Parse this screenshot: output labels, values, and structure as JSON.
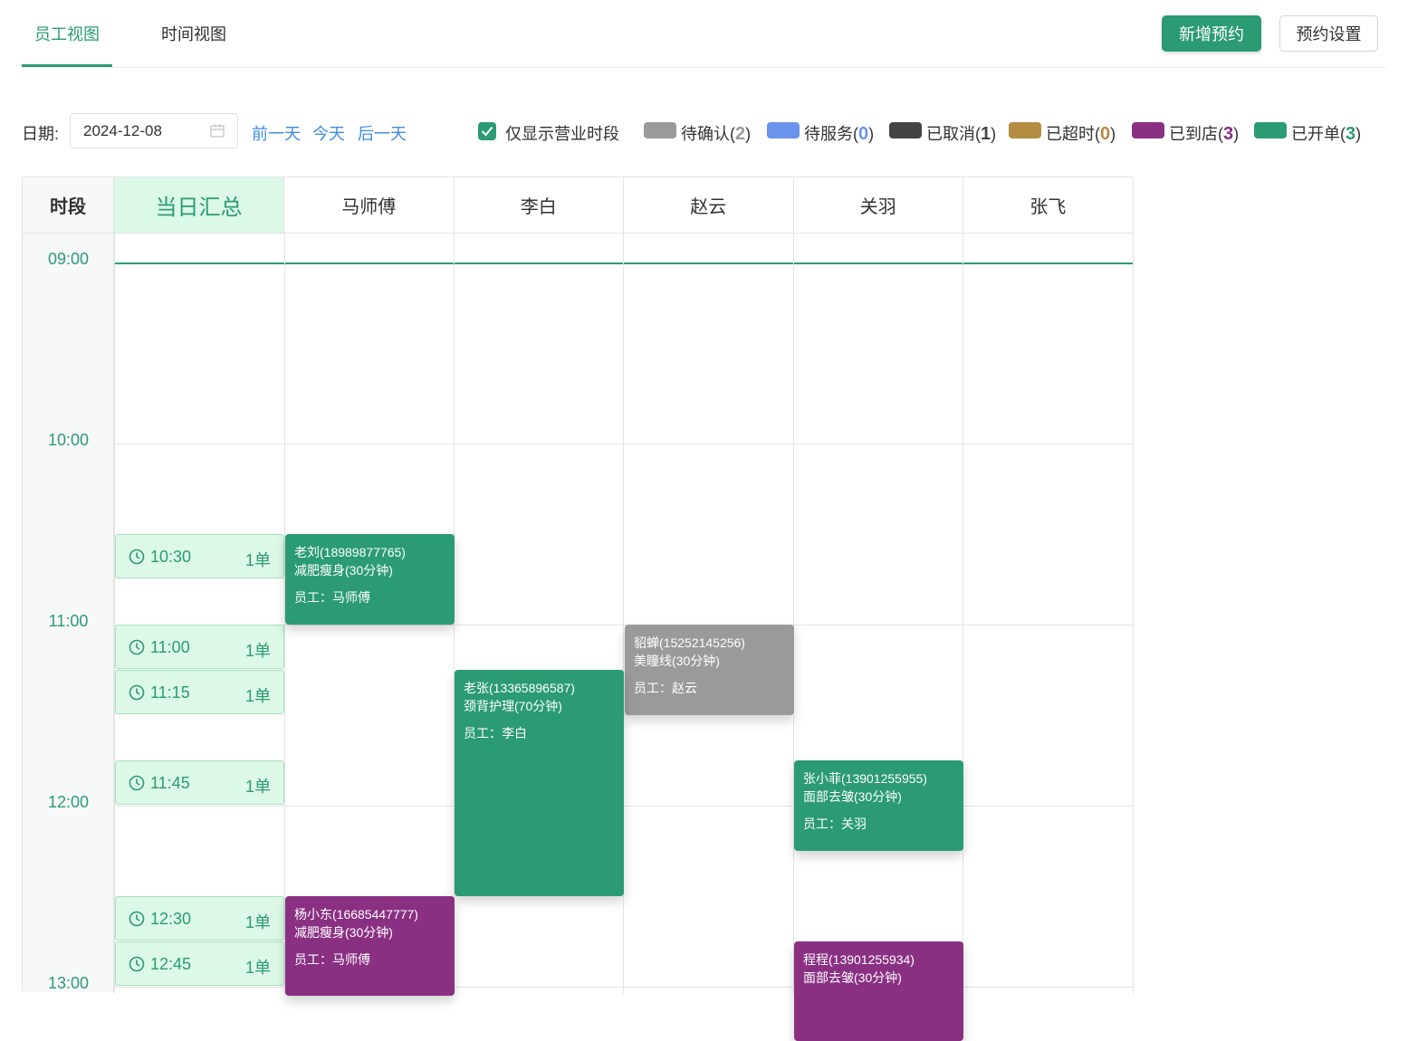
{
  "tabs": [
    {
      "label": "员工视图",
      "active": true
    },
    {
      "label": "时间视图",
      "active": false
    }
  ],
  "actions": {
    "new_label": "新增预约",
    "settings_label": "预约设置"
  },
  "filter": {
    "date_label": "日期:",
    "date_value": "2024-12-08",
    "prev_day": "前一天",
    "today": "今天",
    "next_day": "后一天",
    "checkbox_label": "仅显示营业时段",
    "checkbox_checked": true
  },
  "legend": [
    {
      "label": "待确认",
      "count": "2",
      "color": "#9a9a9a"
    },
    {
      "label": "待服务",
      "count": "0",
      "color": "#6a93ec"
    },
    {
      "label": "已取消",
      "count": "1",
      "color": "#444444"
    },
    {
      "label": "已超时",
      "count": "0",
      "color": "#b48c42"
    },
    {
      "label": "已到店",
      "count": "3",
      "color": "#8a3083"
    },
    {
      "label": "已开单",
      "count": "3",
      "color": "#2b9b74"
    }
  ],
  "grid": {
    "time_header": "时段",
    "summary_header": "当日汇总",
    "staff": [
      "马师傅",
      "李白",
      "赵云",
      "关羽",
      "张飞"
    ],
    "hours": [
      "09:00",
      "10:00",
      "11:00",
      "12:00",
      "13:00"
    ]
  },
  "summary_slots": [
    {
      "time": "10:30",
      "count": "1单"
    },
    {
      "time": "11:00",
      "count": "1单"
    },
    {
      "time": "11:15",
      "count": "1单"
    },
    {
      "time": "11:45",
      "count": "1单"
    },
    {
      "time": "12:30",
      "count": "1单"
    },
    {
      "time": "12:45",
      "count": "1单"
    }
  ],
  "appointments": [
    {
      "customer": "老刘(18989877765)",
      "service": "减肥瘦身(30分钟)",
      "staff": "员工：马师傅",
      "status": "已开单",
      "color": "#2b9b74"
    },
    {
      "customer": "貂蝉(15252145256)",
      "service": "美瞳线(30分钟)",
      "staff": "员工：赵云",
      "status": "待确认",
      "color": "#9a9a9a"
    },
    {
      "customer": "老张(13365896587)",
      "service": "颈背护理(70分钟)",
      "staff": "员工：李白",
      "status": "已开单",
      "color": "#2b9b74"
    },
    {
      "customer": "张小菲(13901255955)",
      "service": "面部去皱(30分钟)",
      "staff": "员工：关羽",
      "status": "已开单",
      "color": "#2b9b74"
    },
    {
      "customer": "杨小东(16685447777)",
      "service": "减肥瘦身(30分钟)",
      "staff": "员工：马师傅",
      "status": "已到店",
      "color": "#8a3083"
    },
    {
      "customer": "程程(13901255934)",
      "service": "面部去皱(30分钟)",
      "staff": "",
      "status": "已到店",
      "color": "#8a3083"
    }
  ]
}
